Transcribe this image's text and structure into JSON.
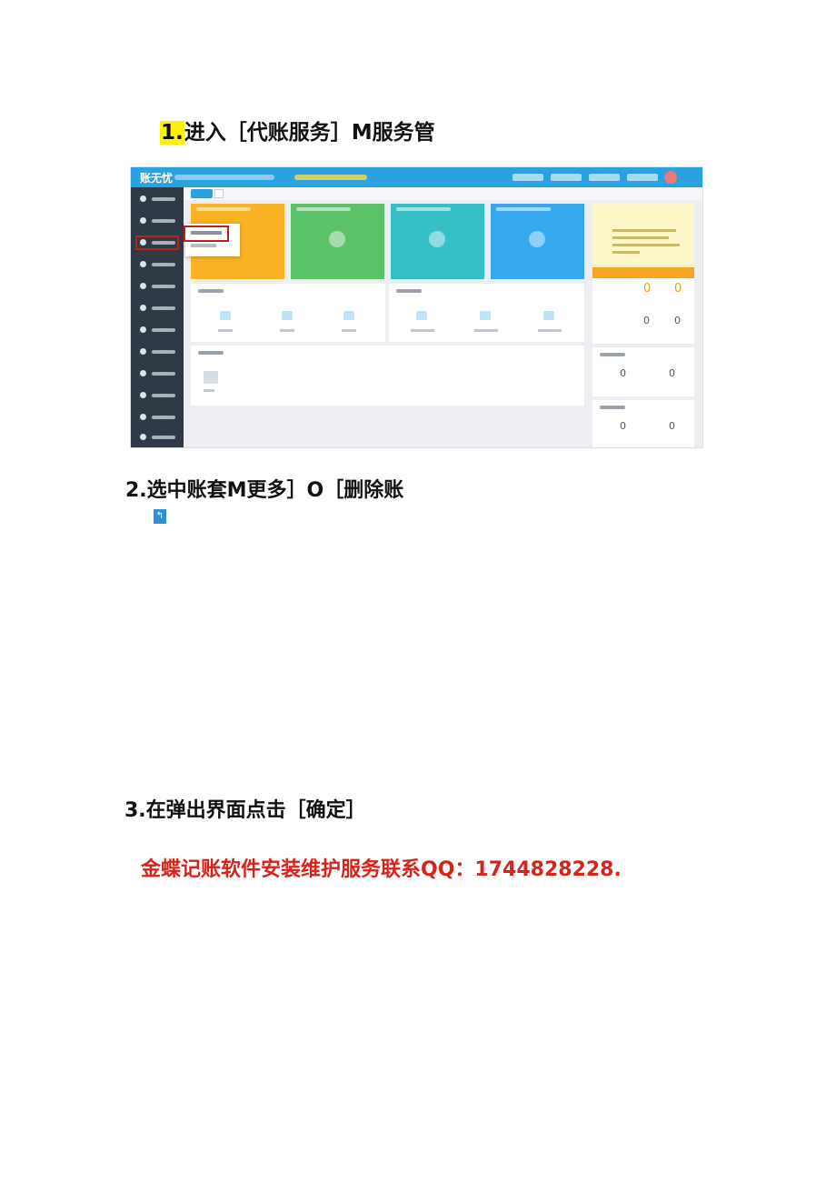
{
  "steps": {
    "step1_num": "1.",
    "step1_text": "进入［代账服务］M服务管",
    "step2": "2.选中账套M更多］O［删除账",
    "step3": "3.在弹出界面点击［确定］"
  },
  "contact": "金蝶记账软件安装维护服务联系QQ：1744828228.",
  "screenshot": {
    "logo": "账无忧",
    "stats": [
      "0",
      "0",
      "0",
      "0",
      "0",
      "0",
      "0",
      "0"
    ]
  },
  "colors": {
    "topbar": "#2aa2e0",
    "sidebar": "#2f3a46",
    "tile_orange": "#fbb224",
    "tile_green": "#5bc26a",
    "tile_teal": "#36c0c6",
    "tile_blue": "#36a8f0",
    "highlight": "#c0201a",
    "contact_red": "#d8231b"
  }
}
